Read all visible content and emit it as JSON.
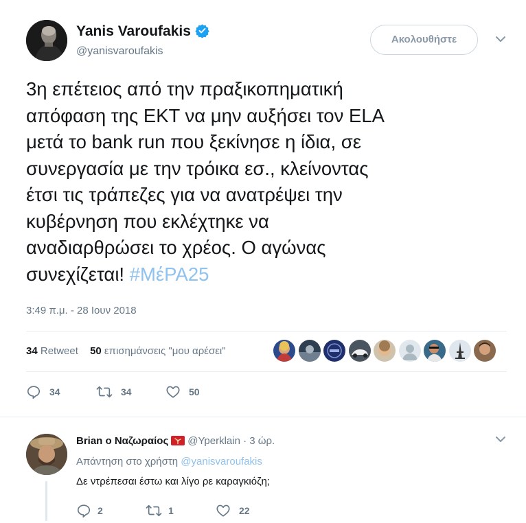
{
  "tweet": {
    "author_name": "Yanis Varoufakis",
    "author_handle": "@yanisvaroufakis",
    "follow_label": "Ακολουθήστε",
    "text": "3η επέτειος από την πραξικοπηματική\nαπόφαση της ΕΚΤ να μην αυξήσει τον ELA\nμετά το bank run που ξεκίνησε η ίδια, σε\nσυνεργασία με την τρόικα εσ., κλείνοντας\nέτσι τις  τράπεζες για να ανατρέψει την\nκυβέρνηση που εκλέχτηκε να\nαναδιαρθρώσει το χρέος. Ο αγώνας\nσυνεχίζεται! ",
    "hashtag": "#ΜέΡΑ25",
    "timestamp": "3:49 π.μ. - 28 Ιουν 2018",
    "stats": {
      "retweet_count": "34",
      "retweet_label": "Retweet",
      "like_count": "50",
      "like_label": "επισημάνσεις \"μου αρέσει\""
    },
    "likers": [
      "liker-1",
      "liker-2",
      "liker-3",
      "liker-4",
      "liker-5",
      "liker-6",
      "liker-7",
      "liker-8",
      "liker-9"
    ],
    "actions": {
      "reply_count": "34",
      "retweet_count": "34",
      "like_count": "50"
    }
  },
  "reply": {
    "author_name": "Brian ο Ναζωραίος",
    "author_handle": "@Yperklain",
    "separator": " · ",
    "time": "3 ώρ.",
    "replying_to_label": "Απάντηση στο χρήστη ",
    "replying_to_handle": "@yanisvaroufakis",
    "text": "Δε ντρέπεσαι έστω και λίγο ρε καραγκιόζη;",
    "actions": {
      "reply_count": "2",
      "retweet_count": "1",
      "like_count": "22"
    }
  },
  "colors": {
    "link": "#8fc2ee",
    "verified": "#1da1f2",
    "muted": "#657786",
    "divider": "#e6ecf0"
  }
}
